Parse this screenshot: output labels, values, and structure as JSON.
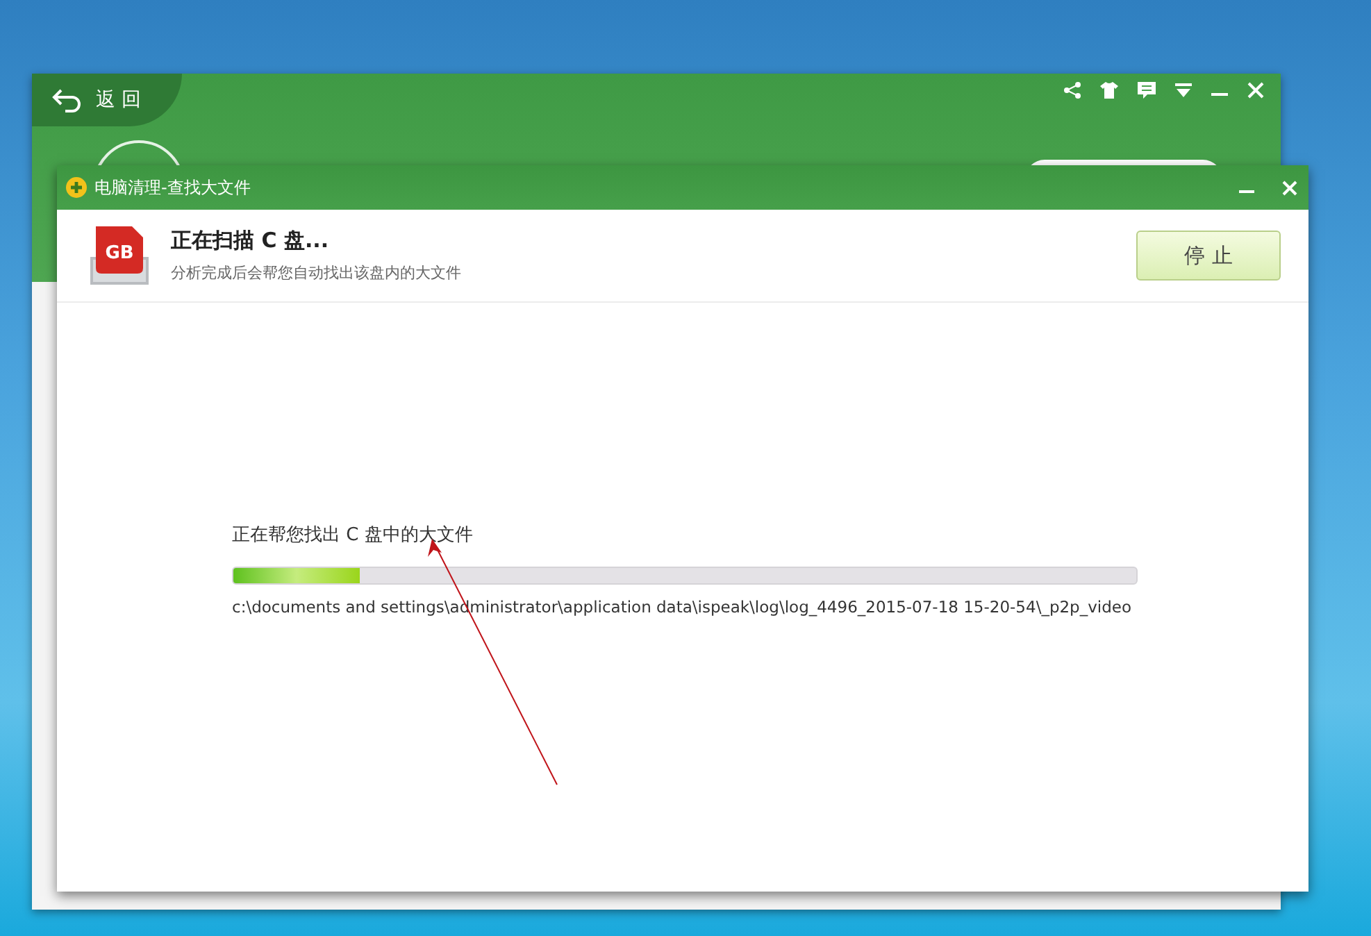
{
  "main_window": {
    "back_label": "返 回"
  },
  "dialog": {
    "title": "电脑清理-查找大文件",
    "icon_label": "GB",
    "header_title": "正在扫描 C 盘...",
    "header_subtitle": "分析完成后会帮您自动找出该盘内的大文件",
    "stop_button": "停 止",
    "scan_label": "正在帮您找出 C 盘中的大文件",
    "progress": {
      "level": 0.14
    },
    "current_path": "c:\\documents and settings\\administrator\\application data\\ispeak\\log\\log_4496_2015-07-18 15-20-54\\_p2p_video"
  }
}
